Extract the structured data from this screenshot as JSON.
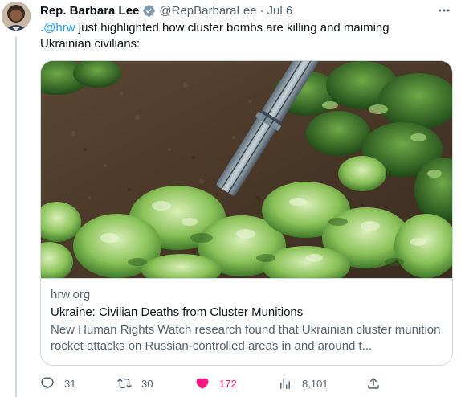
{
  "tweet": {
    "author_name": "Rep. Barbara Lee",
    "handle": "@RepBarbaraLee",
    "separator": "·",
    "date": "Jul 6",
    "text_prefix": ".",
    "mention": "@hrw",
    "text_rest": " just highlighted how cluster bombs are killing and maiming Ukrainian civilians:"
  },
  "card": {
    "domain": "hrw.org",
    "title": "Ukraine: Civilian Deaths from Cluster Munitions",
    "description": "New Human Rights Watch research found that Ukrainian cluster munition rocket attacks on Russian-controlled areas in and around t..."
  },
  "actions": {
    "replies": "31",
    "retweets": "30",
    "likes": "172",
    "views": "8,101"
  },
  "icons": {
    "verified": "verified-badge-icon",
    "more": "more-horizontal-icon",
    "reply": "reply-icon",
    "retweet": "retweet-icon",
    "like": "heart-filled-icon",
    "views": "views-bar-chart-icon",
    "share": "share-upload-icon"
  },
  "colors": {
    "link": "#1d9bf0",
    "like": "#f91880",
    "secondary_text": "#536471",
    "border": "#cfd9de"
  }
}
